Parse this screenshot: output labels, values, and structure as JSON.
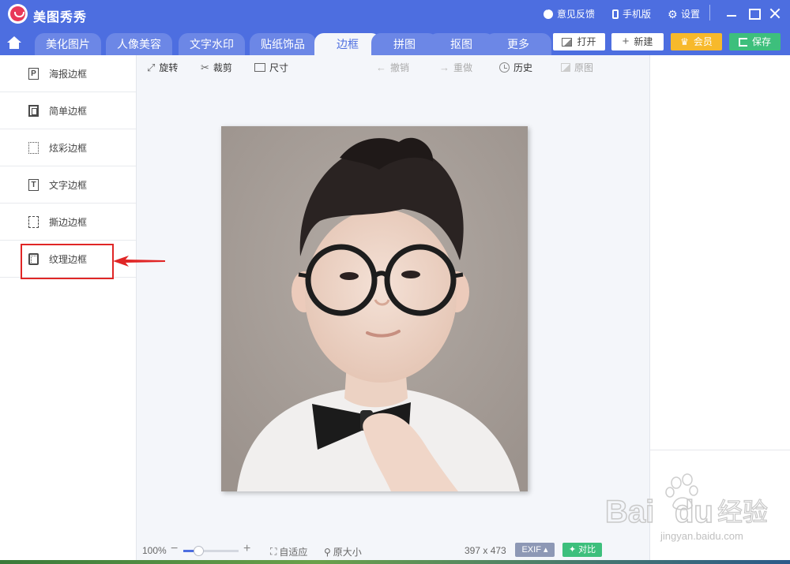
{
  "app": {
    "title": "美图秀秀"
  },
  "titlebar": {
    "feedback": "意见反馈",
    "mobile": "手机版",
    "settings": "设置"
  },
  "tabs": [
    {
      "label": "美化图片"
    },
    {
      "label": "人像美容"
    },
    {
      "label": "文字水印"
    },
    {
      "label": "贴纸饰品"
    },
    {
      "label": "边框",
      "active": true
    },
    {
      "label": "拼图"
    },
    {
      "label": "抠图"
    },
    {
      "label": "更多"
    }
  ],
  "actions": {
    "open": "打开",
    "new": "新建",
    "vip": "会员",
    "save": "保存"
  },
  "sidebar": {
    "items": [
      {
        "label": "海报边框",
        "icon": "P"
      },
      {
        "label": "简单边框",
        "icon": ""
      },
      {
        "label": "炫彩边框",
        "icon": ""
      },
      {
        "label": "文字边框",
        "icon": "T"
      },
      {
        "label": "撕边边框",
        "icon": ""
      },
      {
        "label": "纹理边框",
        "icon": ""
      }
    ]
  },
  "toolbar": {
    "rotate": "旋转",
    "crop": "裁剪",
    "size": "尺寸",
    "undo": "撤销",
    "redo": "重做",
    "history": "历史",
    "original": "原图"
  },
  "statusbar": {
    "zoom": "100%",
    "zoom_level": 0.27,
    "fit": "自适应",
    "actual_size": "原大小",
    "dimensions": "397 x 473",
    "exif": "EXIF",
    "compare": "对比"
  },
  "watermark": {
    "brand": "Bai",
    "brand2": "du",
    "cn": "经验",
    "url": "jingyan.baidu.com"
  },
  "colors": {
    "brand_blue": "#4d6ee0",
    "vip_gold": "#f7b92b",
    "save_green": "#3dbf7c",
    "highlight_red": "#e02626"
  }
}
